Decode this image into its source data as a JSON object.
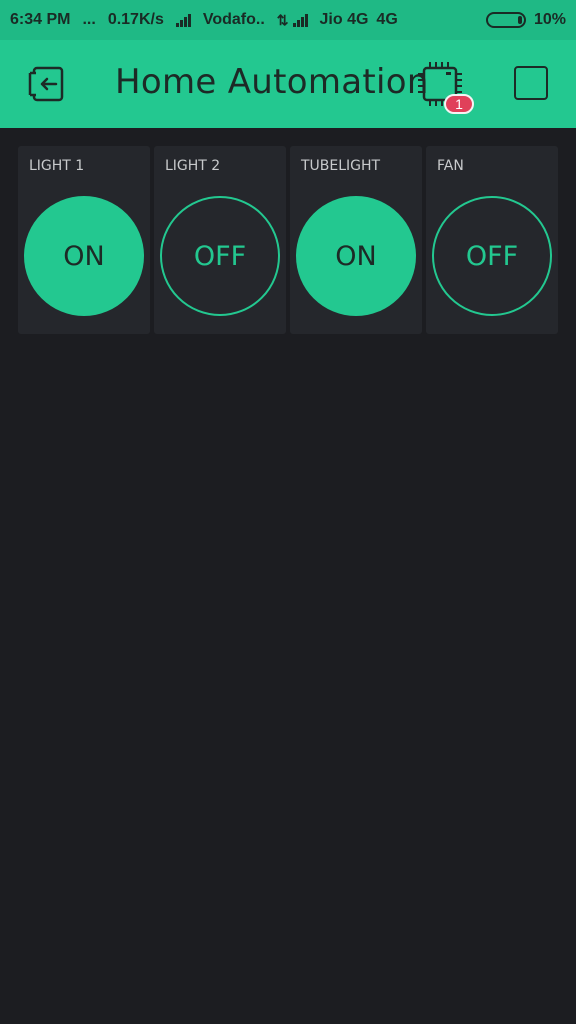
{
  "status_bar": {
    "time": "6:34 PM",
    "dots": "...",
    "speed": "0.17K/s",
    "carrier1": "Vodafo..",
    "carrier2": "Jio 4G",
    "network": "4G",
    "battery": "10%"
  },
  "app_bar": {
    "title": "Home Automation",
    "notification_count": "1",
    "icons": [
      "exit-icon",
      "device-chip-icon",
      "square-icon"
    ]
  },
  "colors": {
    "accent": "#23c890",
    "background": "#1c1d21",
    "widget_bg": "#25272c",
    "badge": "#e0405a"
  },
  "widgets": [
    {
      "label": "LIGHT 1",
      "state": "ON"
    },
    {
      "label": "LIGHT 2",
      "state": "OFF"
    },
    {
      "label": "TUBELIGHT",
      "state": "ON"
    },
    {
      "label": "FAN",
      "state": "OFF"
    }
  ]
}
